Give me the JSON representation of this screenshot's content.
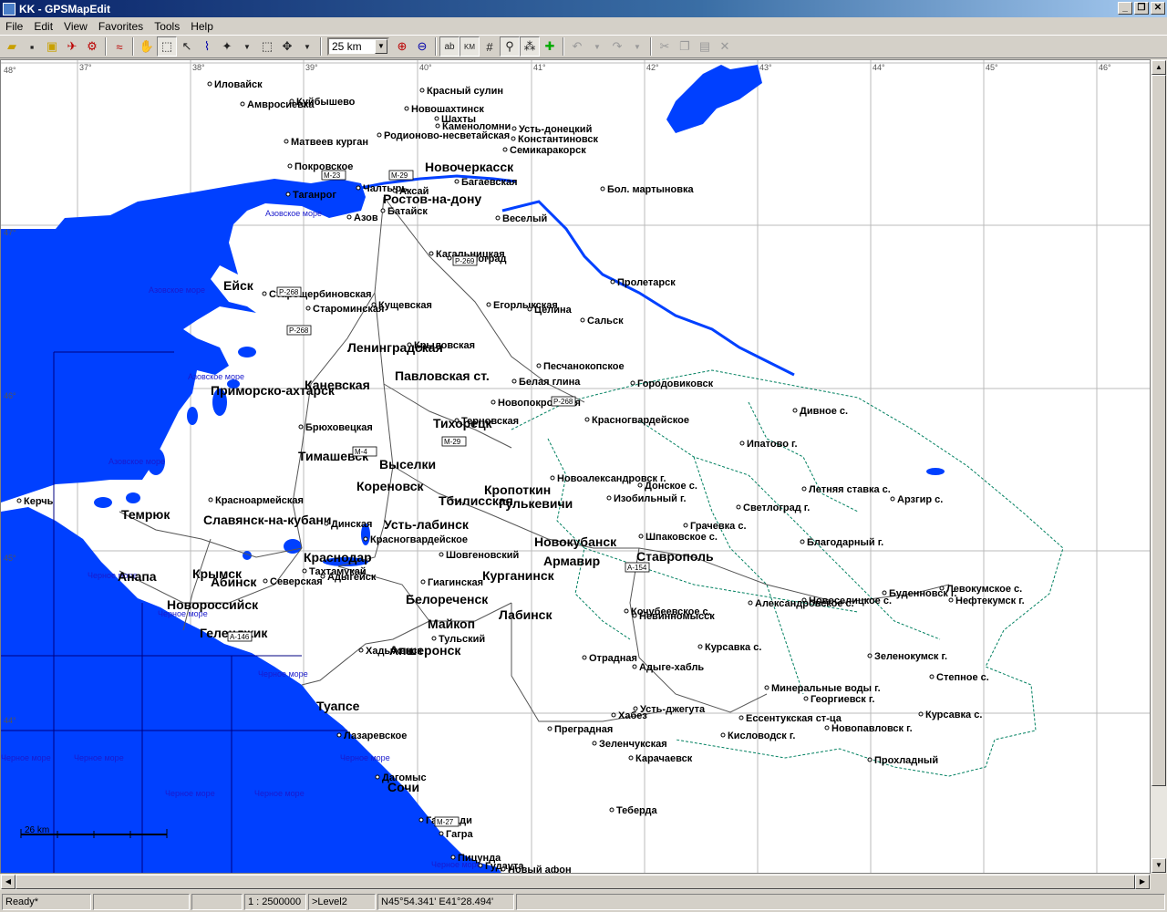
{
  "window": {
    "title": "KK - GPSMapEdit"
  },
  "menu": [
    {
      "label": "File",
      "key": "F"
    },
    {
      "label": "Edit",
      "key": "E"
    },
    {
      "label": "View",
      "key": "V"
    },
    {
      "label": "Favorites",
      "key": "a"
    },
    {
      "label": "Tools",
      "key": "T"
    },
    {
      "label": "Help",
      "key": "H"
    }
  ],
  "toolbar": {
    "zoom_value": "25 km"
  },
  "map": {
    "longitude_labels": [
      "37°",
      "38°",
      "39°",
      "40°",
      "41°",
      "42°",
      "43°",
      "44°",
      "45°",
      "46°"
    ],
    "latitude_labels": [
      "48°",
      "47°",
      "46°",
      "45°",
      "44°"
    ],
    "seas": [
      "Азовское море",
      "Азовское море",
      "Азовское море",
      "Азовское море",
      "Черное море",
      "Черное море",
      "Черное море",
      "Черное море",
      "Черное море",
      "Черное море",
      "Черное море",
      "Черное море",
      "Черное море"
    ],
    "big_cities": [
      "Новочеркасск",
      "Ростов-на-дону",
      "Ейск",
      "Ленинградская",
      "Павловская ст.",
      "Каневская",
      "Приморско-ахтарск",
      "Тихорецк",
      "Тимашевск",
      "Выселки",
      "Кореновск",
      "Тбилисская",
      "Кропоткин",
      "Гулькевичи",
      "Темрюк",
      "Славянск-на-кубани",
      "Усть-лабинск",
      "Новокубанск",
      "Армавир",
      "Ставрополь",
      "Краснодар",
      "Крымск",
      "Анапа",
      "Абинск",
      "Новороссийск",
      "Белореченск",
      "Курганинск",
      "Лабинск",
      "Майкоп",
      "Апшеронск",
      "Геленджик",
      "Туапсе",
      "Сочи"
    ],
    "cities": [
      "Иловайск",
      "Амвросиевка",
      "Куйбышево",
      "Красный сулин",
      "Новошахтинск",
      "Шахты",
      "Каменоломни",
      "Усть-донецкий",
      "Родионово-несветайская",
      "Константиновск",
      "Матвеев курган",
      "Семикаракорск",
      "Покровское",
      "Багаевская",
      "Таганрог",
      "Чалтырь",
      "Аксай",
      "Бол. мартыновка",
      "Азов",
      "Батайск",
      "Веселый",
      "Кагальницкая",
      "Зерноград",
      "Пролетарск",
      "Старощербиновская",
      "Кущевская",
      "Староминская",
      "Егорлыкская",
      "Целина",
      "Сальск",
      "Крыловская",
      "Песчанокопское",
      "Белая глина",
      "Городовиковск",
      "Новопокровская",
      "Дивное с.",
      "Брюховецкая",
      "Терновская",
      "Красногвардейское",
      "Ипатово г.",
      "Новоалександровск г.",
      "Донское с.",
      "Изобильный г.",
      "Летняя ставка с.",
      "Арзгир с.",
      "Красноармейская",
      "Светлоград г.",
      "Динская",
      "Грачевка с.",
      "Шпаковское с.",
      "Благодарный г.",
      "Керчь",
      "Красногвардейское",
      "Шовгеновский",
      "Тахтамукай",
      "Адыгейск",
      "Северская",
      "Гиагинская",
      "Левокумское с.",
      "Буденновск г.",
      "Нефтекумск г.",
      "Новоселицкое с.",
      "Александровское с.",
      "Кочубеевское с.",
      "Невинномысск",
      "Зеленокумск г.",
      "Курсавка с.",
      "Отрадная",
      "Тульский",
      "Хадыженск",
      "Адыге-хабль",
      "Степное с.",
      "Минеральные воды г.",
      "Георгиевск г.",
      "Усть-джегута",
      "Хабез",
      "Ессентукская ст-ца",
      "Курсавка с.",
      "Преградная",
      "Кисловодск г.",
      "Новопавловск г.",
      "Лазаревское",
      "Зеленчукская",
      "Карачаевск",
      "Прохладный",
      "Дагомыс",
      "Теберда",
      "Гантиади",
      "Гагра",
      "Пицунда",
      "Гудаута",
      "Новый афон"
    ],
    "road_signs": [
      "M-23",
      "M-29",
      "P-269",
      "P-268",
      "P-268",
      "M-29",
      "M-4",
      "P-268",
      "A-154",
      "M-27",
      "A-146"
    ],
    "scale_label": "26 km"
  },
  "status": {
    "state": "Ready*",
    "scale": "1 : 2500000",
    "level": ">Level2",
    "coords": "N45°54.341' E41°28.494'"
  }
}
